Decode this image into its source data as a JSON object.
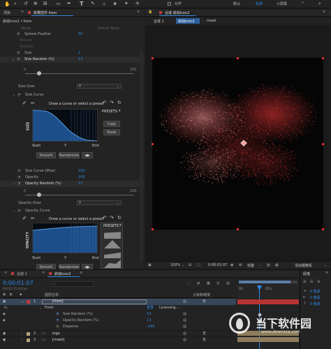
{
  "toolbar": {
    "snap_label": "对齐",
    "workspace_default": "默认",
    "workspace_standard": "标准",
    "workspace_small": "小屏幕",
    "more": "»"
  },
  "left_panel": {
    "tab_project": "项目",
    "tab_effects": "效果控件 from",
    "breadcrumb": "启动icon2 • from",
    "col_spray": "Spray",
    "col_spray_val": "Directi Sphe…",
    "rows": [
      {
        "name": "Sphere Feather",
        "value": "50",
        "active": true
      },
      {
        "name": "Texture",
        "value": "",
        "active": false
      },
      {
        "name": "Rotation",
        "value": "",
        "active": false
      },
      {
        "name": "Size",
        "value": "2",
        "active": true
      },
      {
        "name": "Size Random (%)",
        "value": "13",
        "active": true
      }
    ],
    "slider1": {
      "min": "0",
      "max": "100",
      "value": 0.13
    },
    "size_over_label": "Size Over",
    "size_over_value": "Y",
    "size_curve_label": "Size Curve",
    "curve_hint": "Draw a curve or select a preset",
    "presets_label": "PRESETS",
    "copy_label": "Copy",
    "paste_label": "Paste",
    "axis_size": "SIZE",
    "axis_opacity": "OPACITY",
    "start_label": "Start",
    "y_label": "Y",
    "end_label": "End",
    "smooth_label": "Smooth",
    "randomize_label": "Randomize",
    "rows2": [
      {
        "name": "Size Curve Offset",
        "value": "100"
      },
      {
        "name": "Opacity",
        "value": "100"
      },
      {
        "name": "Opacity Random (%)",
        "value": "13"
      }
    ],
    "slider2": {
      "min": "0",
      "max": "100",
      "value": 0.13
    },
    "opacity_over_label": "Opacity Over",
    "opacity_over_value": "Y",
    "opacity_curve_label": "Opacity Curve"
  },
  "composition": {
    "tab_label": "合成 启动icon2",
    "crumb1": "合成 1",
    "crumb2": "启动icon2",
    "crumb3": "mask",
    "zoom": "100%",
    "timecode": "0:00:01:07",
    "quality": "完整",
    "camera": "活动摄像机"
  },
  "timeline": {
    "tab1": "合成 1",
    "tab2": "启动icon2",
    "timecode": "0:00:01:07",
    "frames": "00032 (25.00 fps)",
    "col_layer_name": "图层名称",
    "col_parent": "父级和链接",
    "rows": [
      {
        "num": "1",
        "name": "[from]",
        "parent": "无",
        "selected": true
      },
      {
        "name": "Form",
        "value": "重置",
        "extra": "Licensing..."
      },
      {
        "name": "Size Random (%)",
        "value": "13"
      },
      {
        "name": "Opacity Random (%)",
        "value": "13"
      },
      {
        "name": "Disperse",
        "value": "-144"
      },
      {
        "num": "2",
        "name": "logo",
        "parent": "无"
      },
      {
        "num": "3",
        "name": "[mask]",
        "parent": "无"
      }
    ],
    "ruler_start": "0s",
    "ruler_mid": "01s"
  },
  "right_panel": {
    "tab": "段落",
    "px1": "0 像素",
    "px2": "0 像素",
    "px3": "0 像素"
  },
  "watermark": "当下软件园",
  "watermark_url": "www.downxia.com"
}
